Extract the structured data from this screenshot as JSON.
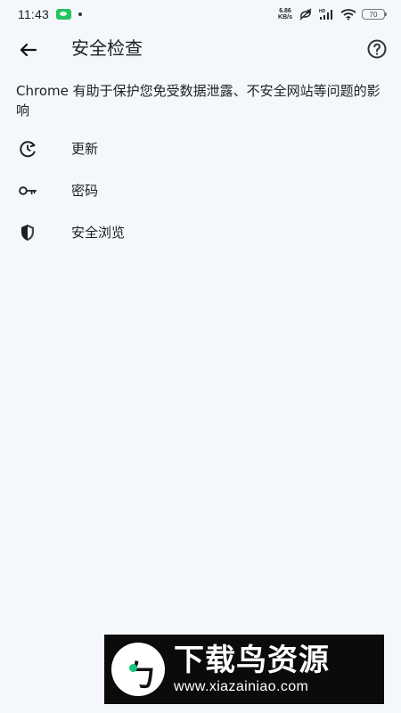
{
  "status_bar": {
    "time": "11:43",
    "network_speed_top": "6.86",
    "network_speed_bottom": "KB/s",
    "battery": "70"
  },
  "header": {
    "title": "安全检查"
  },
  "content": {
    "description": "Chrome 有助于保护您免受数据泄露、不安全网站等问题的影响",
    "items": [
      {
        "label": "更新",
        "icon": "update-icon"
      },
      {
        "label": "密码",
        "icon": "key-icon"
      },
      {
        "label": "安全浏览",
        "icon": "shield-icon"
      }
    ]
  },
  "watermark": {
    "brand": "下载鸟资源",
    "url": "www.xiazainiao.com"
  },
  "colors": {
    "background": "#f4f8fd",
    "text": "#1f1f1f",
    "watermark_bg": "#0b0b0b",
    "watermark_accent": "#13c77c"
  }
}
